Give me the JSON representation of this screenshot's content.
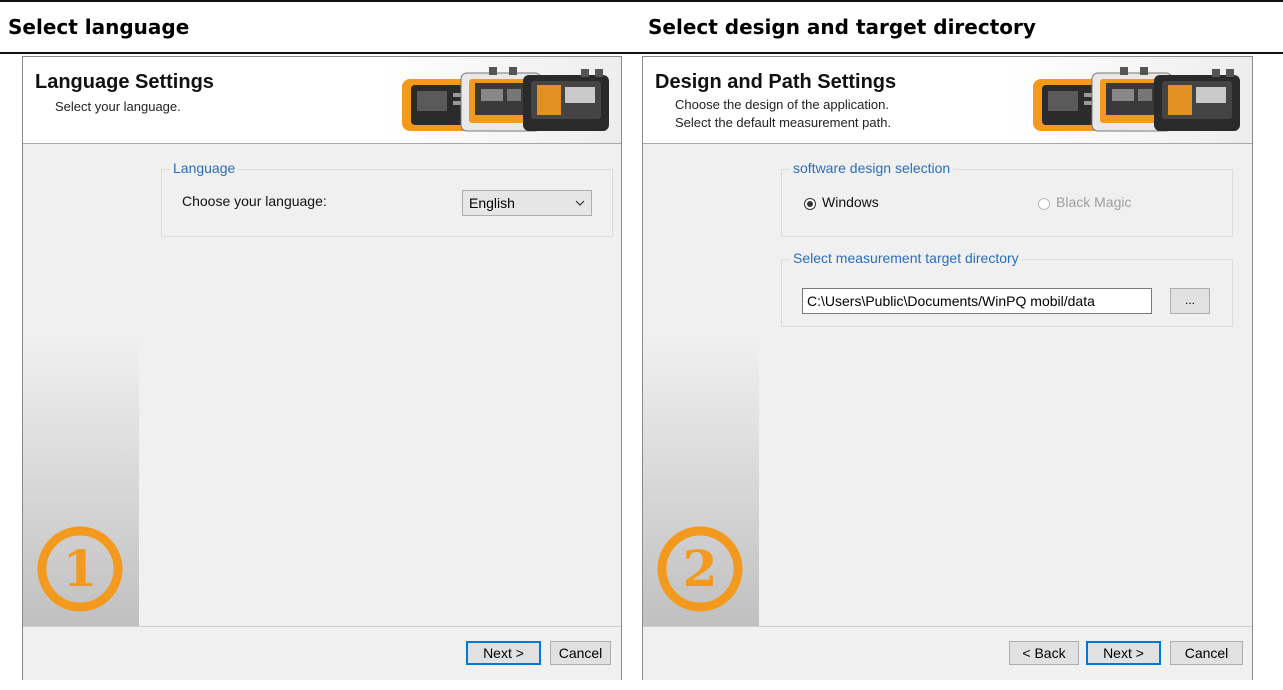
{
  "page": {
    "left_heading": "Select language",
    "right_heading": "Select design and target directory"
  },
  "step1": {
    "title": "Language Settings",
    "subtitle": "Select your language.",
    "group_label": "Language",
    "choose_label": "Choose your language:",
    "language_value": "English",
    "badge": "1",
    "next_label": "Next >",
    "cancel_label": "Cancel"
  },
  "step2": {
    "title": "Design and Path Settings",
    "subtitle_line1": "Choose the design of the application.",
    "subtitle_line2": "Select the default measurement path.",
    "design_group_label": "software design selection",
    "radio_windows": "Windows",
    "radio_windows_checked": true,
    "radio_black_magic": "Black Magic",
    "radio_black_magic_enabled": false,
    "dir_group_label": "Select measurement target directory",
    "dir_value": "C:\\Users\\Public\\Documents/WinPQ mobil/data",
    "browse_label": "...",
    "badge": "2",
    "back_label": "< Back",
    "next_label": "Next >",
    "cancel_label": "Cancel"
  },
  "colors": {
    "accent_orange": "#f39a1e",
    "group_label_blue": "#2a6ebb",
    "focus_border": "#0078d7"
  }
}
